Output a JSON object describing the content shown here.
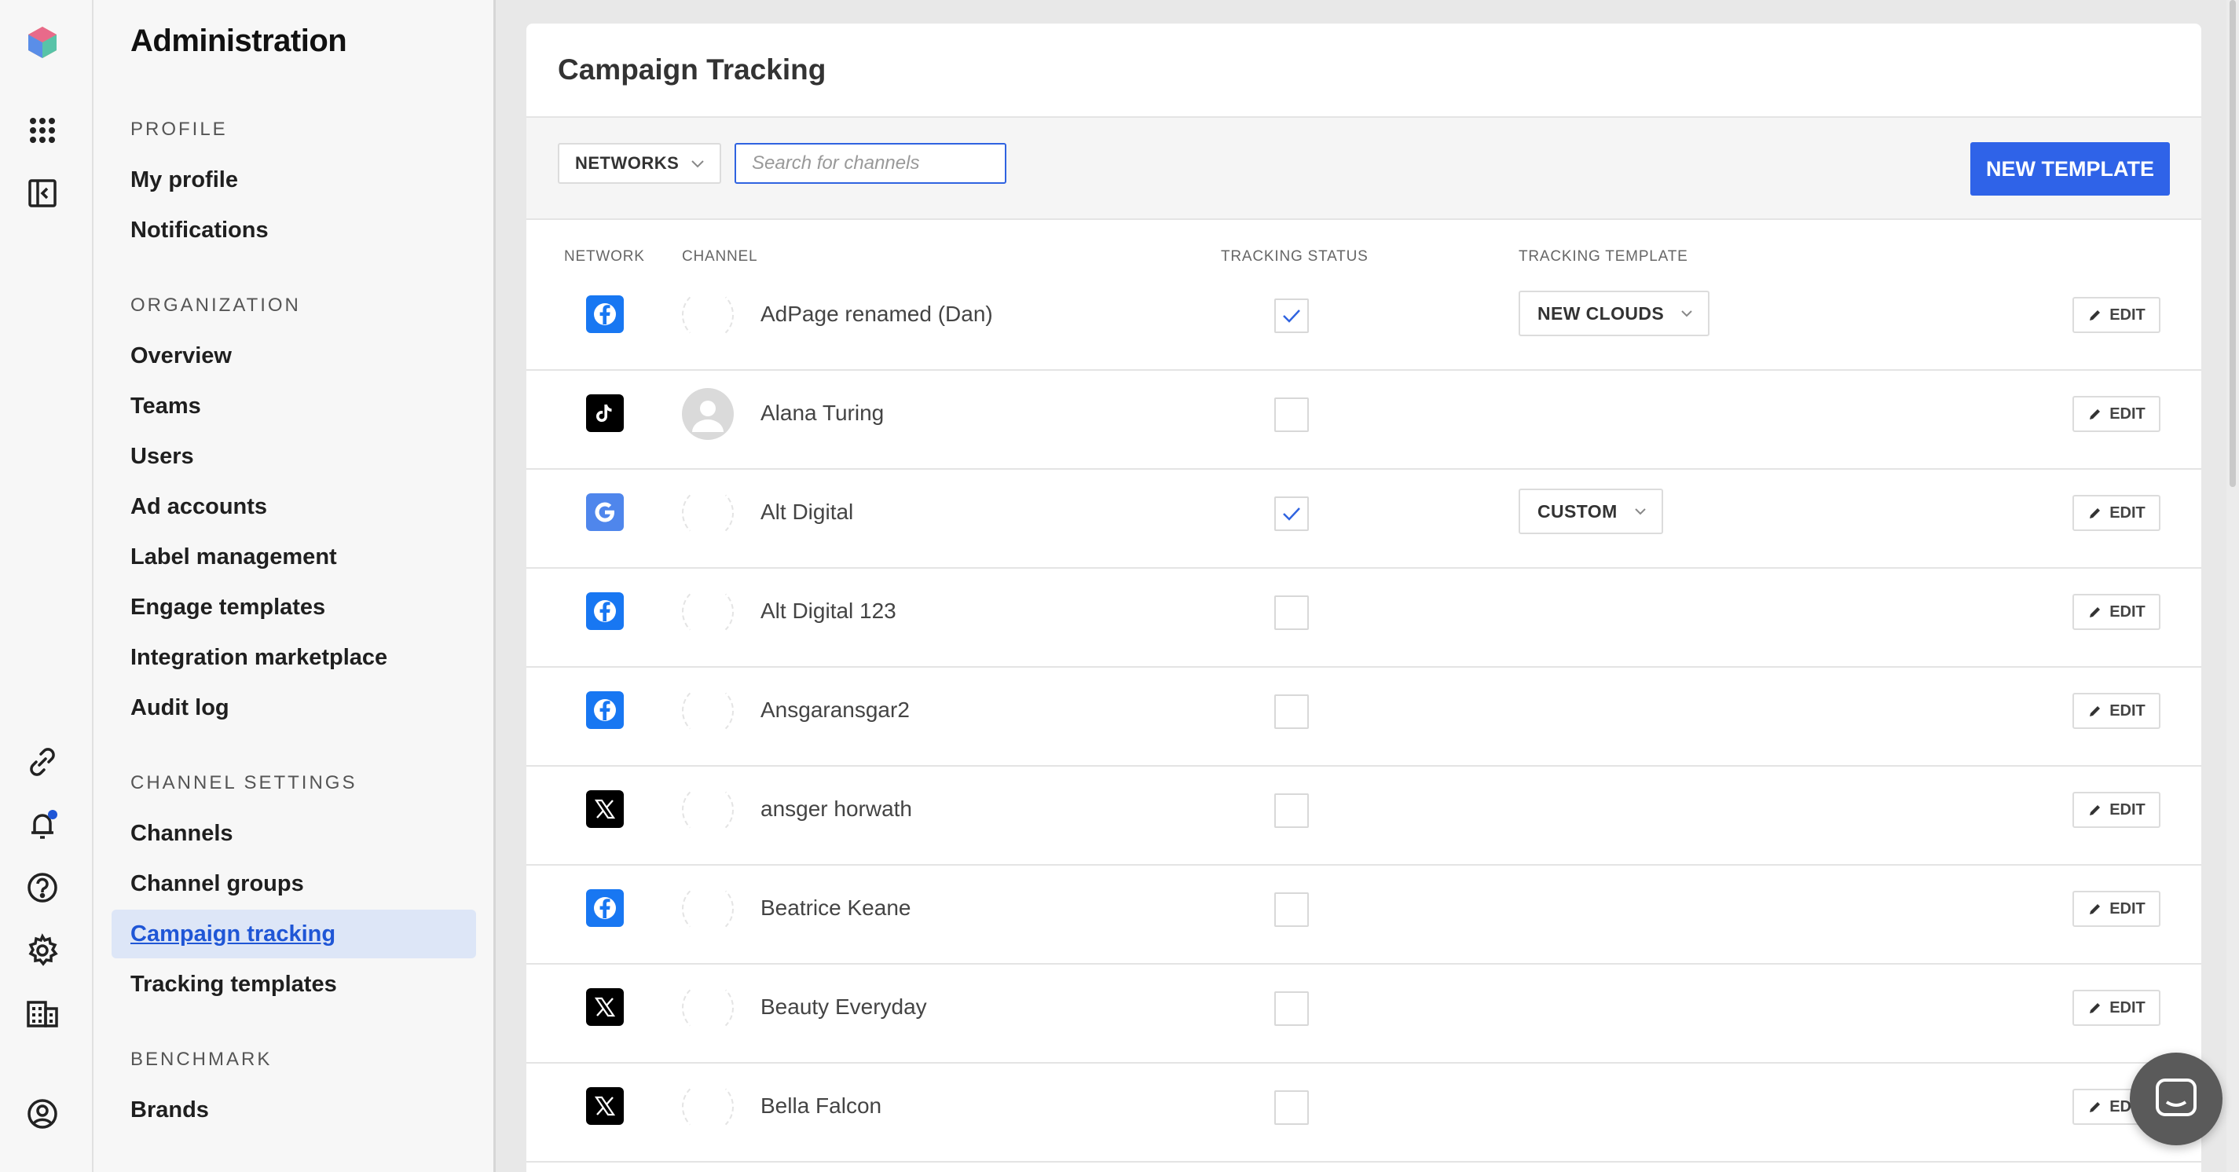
{
  "sidebar": {
    "title": "Administration",
    "sections": [
      {
        "label": "PROFILE",
        "items": [
          "My profile",
          "Notifications"
        ]
      },
      {
        "label": "ORGANIZATION",
        "items": [
          "Overview",
          "Teams",
          "Users",
          "Ad accounts",
          "Label management",
          "Engage templates",
          "Integration marketplace",
          "Audit log"
        ]
      },
      {
        "label": "CHANNEL SETTINGS",
        "items": [
          "Channels",
          "Channel groups",
          "Campaign tracking",
          "Tracking templates"
        ]
      },
      {
        "label": "BENCHMARK",
        "items": [
          "Brands"
        ]
      }
    ],
    "active_item": "Campaign tracking"
  },
  "rail": {
    "icons": [
      "app-logo-icon",
      "apps-grid-icon",
      "sidebar-toggle-icon",
      "link-icon",
      "bell-icon",
      "help-icon",
      "gear-icon",
      "building-icon",
      "account-icon"
    ],
    "notification_dot_color": "#1f56d6"
  },
  "main": {
    "title": "Campaign Tracking",
    "networks_filter": "NETWORKS",
    "search_placeholder": "Search for channels",
    "new_template_label": "NEW TEMPLATE",
    "columns": {
      "network": "NETWORK",
      "channel": "CHANNEL",
      "tracking_status": "TRACKING STATUS",
      "tracking_template": "TRACKING TEMPLATE"
    },
    "edit_label": "EDIT",
    "rows": [
      {
        "network": "facebook",
        "channel": "AdPage renamed (Dan)",
        "tracking": true,
        "template": "NEW CLOUDS",
        "avatar": "blank"
      },
      {
        "network": "tiktok",
        "channel": "Alana Turing",
        "tracking": false,
        "template": "",
        "avatar": "person"
      },
      {
        "network": "google",
        "channel": "Alt Digital",
        "tracking": true,
        "template": "CUSTOM",
        "avatar": "blank"
      },
      {
        "network": "facebook",
        "channel": "Alt Digital 123",
        "tracking": false,
        "template": "",
        "avatar": "blank"
      },
      {
        "network": "facebook",
        "channel": "Ansgaransgar2",
        "tracking": false,
        "template": "",
        "avatar": "blank"
      },
      {
        "network": "x",
        "channel": "ansger horwath",
        "tracking": false,
        "template": "",
        "avatar": "blank"
      },
      {
        "network": "facebook",
        "channel": "Beatrice Keane",
        "tracking": false,
        "template": "",
        "avatar": "blank"
      },
      {
        "network": "x",
        "channel": "Beauty Everyday",
        "tracking": false,
        "template": "",
        "avatar": "blank"
      },
      {
        "network": "x",
        "channel": "Bella Falcon",
        "tracking": false,
        "template": "",
        "avatar": "blank"
      }
    ]
  },
  "colors": {
    "accent": "#2f63e8",
    "facebook": "#1877f2",
    "google": "#4f86ec",
    "tiktok": "#000000",
    "x": "#000000"
  }
}
